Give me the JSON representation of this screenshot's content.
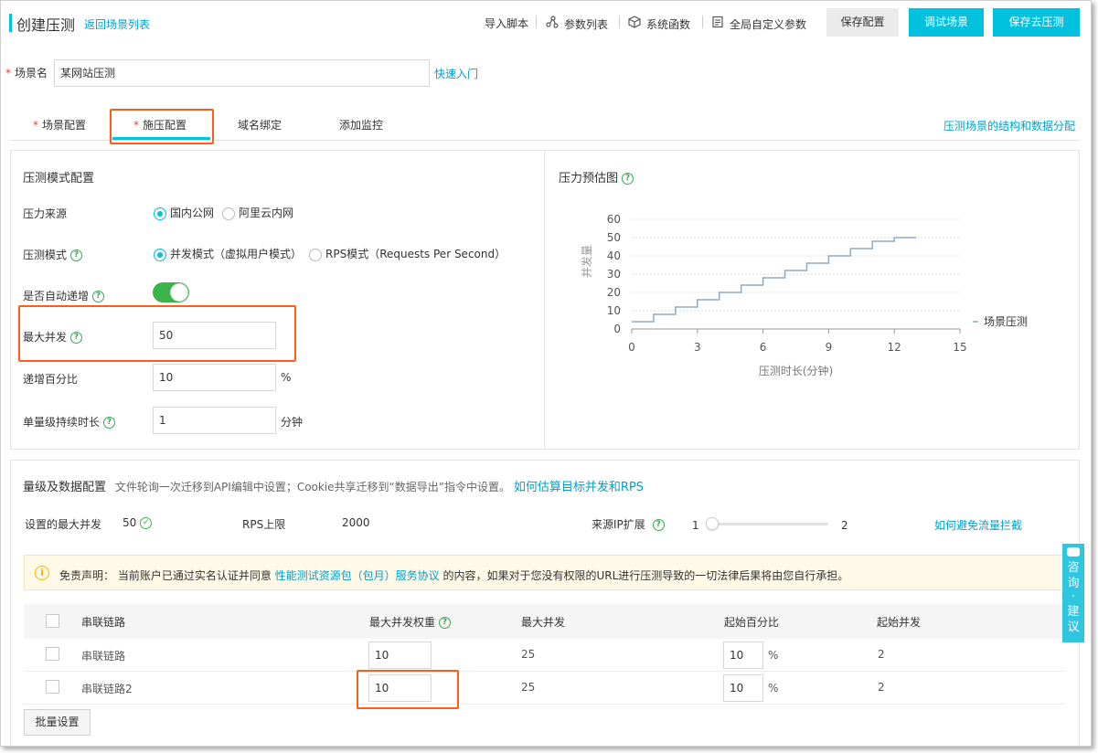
{
  "header": {
    "title": "创建压测",
    "back_link": "返回场景列表",
    "toolbar": {
      "import_script": "导入脚本",
      "param_list": "参数列表",
      "system_func": "系统函数",
      "global_params": "全局自定义参数",
      "save_config": "保存配置",
      "debug_scene": "调试场景",
      "save_and_test": "保存去压测"
    }
  },
  "scene": {
    "label": "场景名",
    "value": "某网站压测",
    "quick_start": "快速入门"
  },
  "tabs": {
    "items": [
      {
        "label": "场景配置",
        "required": true
      },
      {
        "label": "施压配置",
        "required": true,
        "active": true
      },
      {
        "label": "域名绑定"
      },
      {
        "label": "添加监控"
      }
    ],
    "right_link": "压测场景的结构和数据分配"
  },
  "pressure_mode": {
    "title": "压测模式配置",
    "source_label": "压力来源",
    "source_options": [
      "国内公网",
      "阿里云内网"
    ],
    "mode_label": "压测模式",
    "mode_options": [
      "并发模式（虚拟用户模式）",
      "RPS模式（Requests Per Second）"
    ],
    "auto_increase_label": "是否自动递增",
    "max_concurrency_label": "最大并发",
    "max_concurrency_value": "50",
    "increase_percent_label": "递增百分比",
    "increase_percent_value": "10",
    "percent_unit": "%",
    "level_duration_label": "单量级持续时长",
    "level_duration_value": "1",
    "minute_unit": "分钟"
  },
  "chart_panel": {
    "title": "压力预估图"
  },
  "chart_data": {
    "type": "line",
    "step": true,
    "title": "",
    "xlabel": "压测时长(分钟)",
    "ylabel": "并发量",
    "xlim": [
      0,
      15
    ],
    "ylim": [
      0,
      60
    ],
    "x_ticks": [
      0,
      3,
      6,
      9,
      12,
      15
    ],
    "y_ticks": [
      0,
      10,
      20,
      30,
      40,
      50,
      60
    ],
    "grid": true,
    "legend": "right",
    "series": [
      {
        "name": "场景压测",
        "color": "#8ea9c8",
        "x": [
          0,
          1,
          1,
          2,
          2,
          3,
          3,
          4,
          4,
          5,
          5,
          6,
          6,
          7,
          7,
          8,
          8,
          9,
          9,
          10,
          10,
          11,
          11,
          12,
          12,
          13
        ],
        "y": [
          4,
          4,
          8,
          8,
          12,
          12,
          16,
          16,
          20,
          20,
          24,
          24,
          28,
          28,
          32,
          32,
          36,
          36,
          40,
          40,
          44,
          44,
          48,
          48,
          50,
          50
        ]
      }
    ]
  },
  "level_config": {
    "title": "量级及数据配置",
    "note": "文件轮询一次迁移到API编辑中设置；Cookie共享迁移到“数据导出”指令中设置。",
    "estimate_link": "如何估算目标并发和RPS",
    "set_max_label": "设置的最大并发",
    "set_max_value": "50",
    "rps_label": "RPS上限",
    "rps_value": "2000",
    "source_ip_label": "来源IP扩展",
    "slider_min": "1",
    "slider_max": "2",
    "slider_level": 0.0,
    "avoid_link": "如何避免流量拦截"
  },
  "disclaimer": {
    "prefix": "免责声明：  当前账户已通过实名认证并同意",
    "link": "性能测试资源包（包月）服务协议",
    "suffix": "的内容，如果对于您没有权限的URL进行压测导致的一切法律后果将由您自行承担。"
  },
  "table": {
    "headers": [
      "串联链路",
      "最大并发权重",
      "最大并发",
      "起始百分比",
      "起始并发"
    ],
    "rows": [
      {
        "name": "串联链路",
        "weight": "10",
        "max": "25",
        "start_pct": "10",
        "start_conc": "2"
      },
      {
        "name": "串联链路2",
        "weight": "10",
        "max": "25",
        "start_pct": "10",
        "start_conc": "2"
      }
    ],
    "pct_unit": "%",
    "batch_button": "批量设置"
  },
  "side_widget": {
    "chars": [
      "咨",
      "询",
      "·",
      "建",
      "议"
    ]
  },
  "colors": {
    "accent": "#00c1de",
    "link": "#00a2ca",
    "toggle_on": "#3ab54a",
    "highlight_border": "#ff5b1f",
    "required": "#e8432d"
  }
}
